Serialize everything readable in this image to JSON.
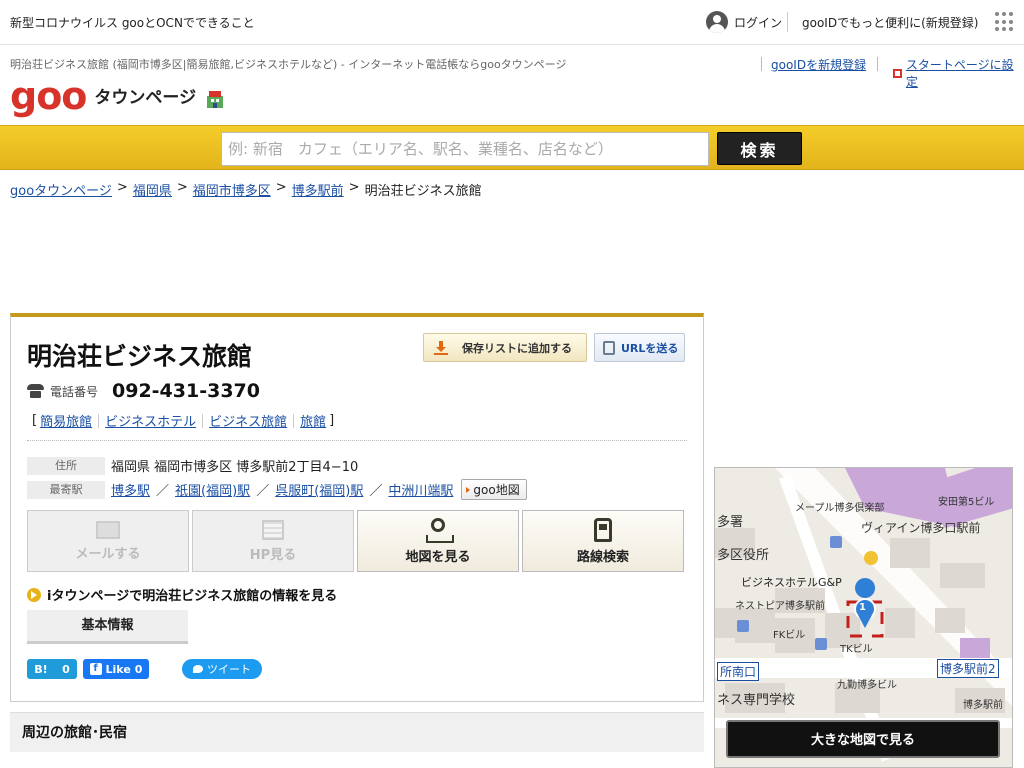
{
  "topbar": {
    "news": "新型コロナウイルス gooとOCNでできること",
    "login": "ログイン",
    "signup": "gooIDでもっと便利に(新規登録)"
  },
  "header": {
    "tagline": "明治荘ビジネス旅館 (福岡市博多区|簡易旅館,ビジネスホテルなど) - インターネット電話帳ならgooタウンページ",
    "logo_goo": "goo",
    "logo_tp": "タウンページ",
    "gooid_signup": "gooIDを新規登録",
    "set_start": "スタートページに設定"
  },
  "search": {
    "placeholder": "例: 新宿　カフェ（エリア名、駅名、業種名、店名など）",
    "button": "検索"
  },
  "breadcrumb": {
    "items": [
      "gooタウンページ",
      "福岡県",
      "福岡市博多区",
      "博多駅前"
    ],
    "current": "明治荘ビジネス旅館",
    "sep": ">"
  },
  "shop": {
    "name": "明治荘ビジネス旅館",
    "save_label": "保存リストに追加する",
    "url_label": "URLを送る",
    "tel_label": "電話番号",
    "tel": "092-431-3370",
    "bracket_open": "[",
    "bracket_close": "]",
    "categories": [
      "簡易旅館",
      "ビジネスホテル",
      "ビジネス旅館",
      "旅館"
    ],
    "address_label": "住所",
    "address": "福岡県 福岡市博多区 博多駅前2丁目4−10",
    "station_label": "最寄駅",
    "stations": [
      "博多駅",
      "祇園(福岡)駅",
      "呉服町(福岡)駅",
      "中洲川端駅"
    ],
    "slash": "／",
    "goomap": "goo地図"
  },
  "actions": {
    "mail": "メールする",
    "hp": "HP見る",
    "map": "地図を見る",
    "route": "路線検索"
  },
  "itown": "iタウンページで明治荘ビジネス旅館の情報を見る",
  "tab_basic": "基本情報",
  "social": {
    "hatena": "B!",
    "hatena_count": "0",
    "fb_like": "Like",
    "fb_count": "0",
    "tweet": "ツイート"
  },
  "nearby_title": "周辺の旅館･民宿",
  "map": {
    "labels": [
      "メープル博多倶楽部",
      "安田第5ビル",
      "多署",
      "ヴィアイン博多口駅前",
      "多区役所",
      "ビジネスホテルG&P",
      "ネストピア博多駅前",
      "FKビル",
      "TKビル",
      "所南口",
      "博多駅前2",
      "九勤博多ビル",
      "ネス専門学校",
      "博多駅前"
    ],
    "marker": "1",
    "big_map": "大きな地図で見る"
  },
  "colors": {
    "accent": "#e3b41b",
    "logo": "#d8332b",
    "link": "#1a4fa3"
  }
}
